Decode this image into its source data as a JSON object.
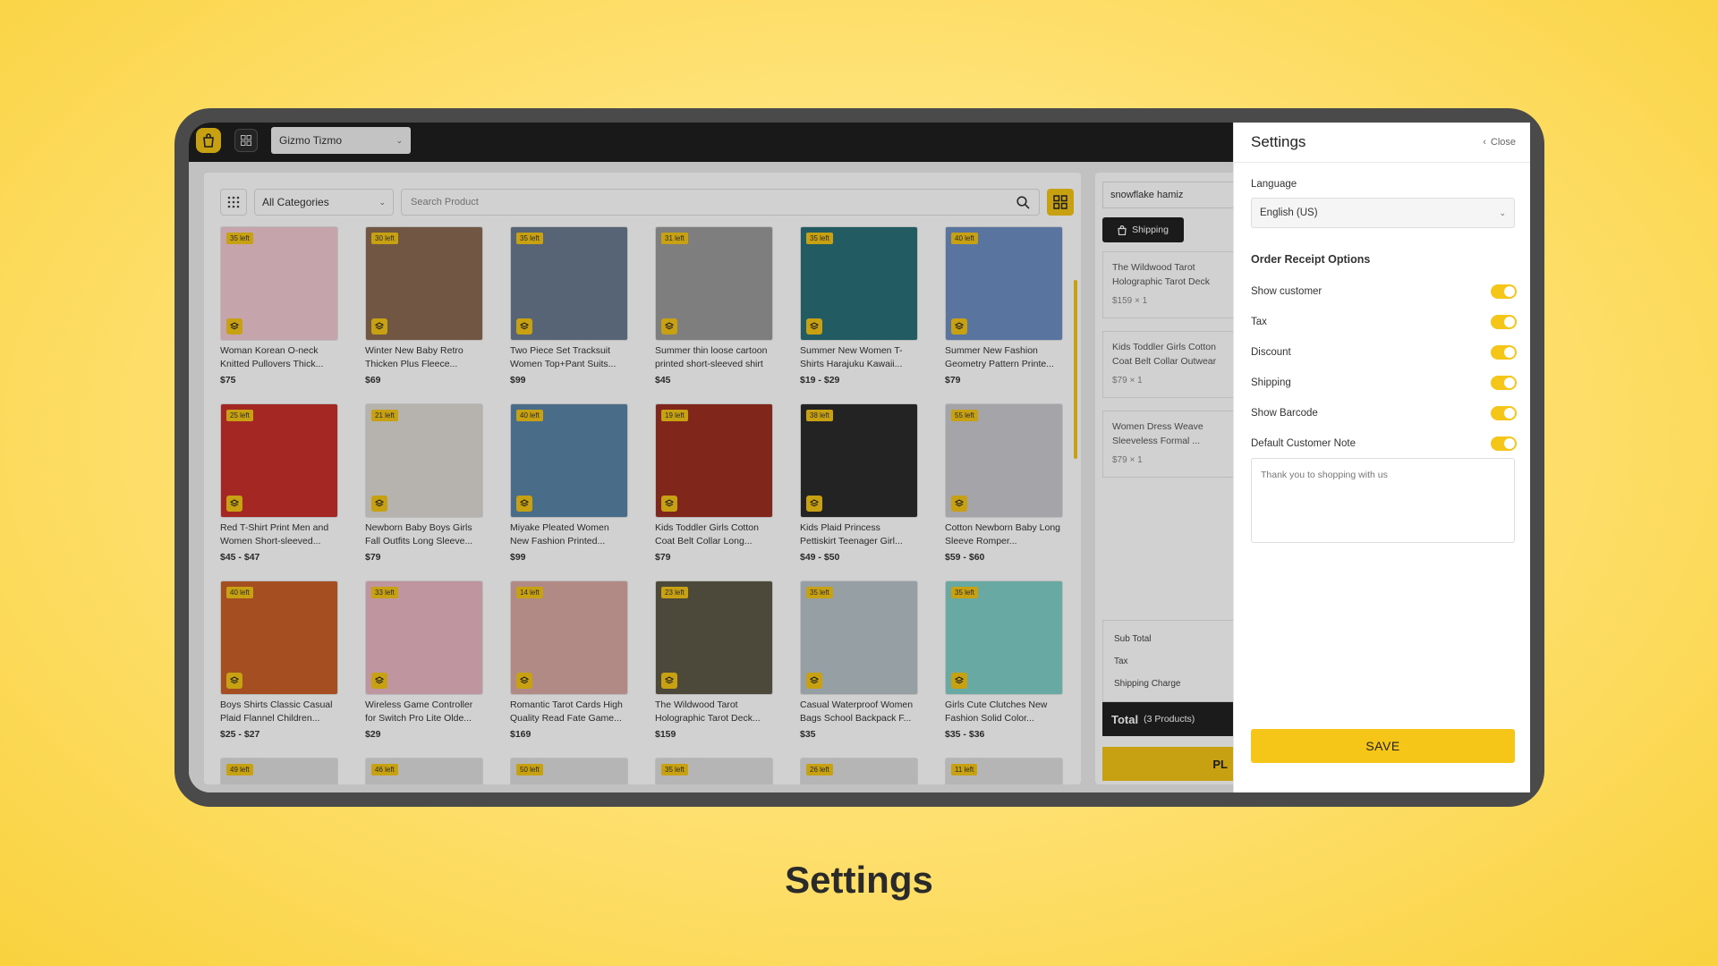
{
  "topbar": {
    "store_name": "Gizmo Tizmo"
  },
  "filters": {
    "category": "All Categories",
    "search_placeholder": "Search Product"
  },
  "products": [
    {
      "stock": "35 left",
      "name": "Woman Korean O-neck Knitted Pullovers Thick...",
      "price": "$75",
      "color": "#f2c9d1"
    },
    {
      "stock": "30 left",
      "name": "Winter New Baby Retro Thicken Plus Fleece...",
      "price": "$69",
      "color": "#8a6a52"
    },
    {
      "stock": "35 left",
      "name": "Two Piece Set Tracksuit Women Top+Pant Suits...",
      "price": "$99",
      "color": "#6b7a91"
    },
    {
      "stock": "31 left",
      "name": "Summer thin loose cartoon printed short-sleeved shirt",
      "price": "$45",
      "color": "#9a9a9a"
    },
    {
      "stock": "35 left",
      "name": "Summer New Women T-Shirts Harajuku Kawaii...",
      "price": "$19 - $29",
      "color": "#2a6f78"
    },
    {
      "stock": "40 left",
      "name": "Summer New Fashion Geometry Pattern Printe...",
      "price": "$79",
      "color": "#6d8fc2"
    },
    {
      "stock": "25 left",
      "name": "Red T-Shirt Print Men and Women Short-sleeved...",
      "price": "$45 - $47",
      "color": "#c9302c"
    },
    {
      "stock": "21 left",
      "name": "Newborn Baby Boys Girls Fall Outfits Long Sleeve...",
      "price": "$79",
      "color": "#ded9d3"
    },
    {
      "stock": "40 left",
      "name": "Miyake Pleated Women New Fashion Printed...",
      "price": "$99",
      "color": "#5a86a8"
    },
    {
      "stock": "19 left",
      "name": "Kids Toddler Girls Cotton Coat Belt Collar Long...",
      "price": "$79",
      "color": "#9e2f22"
    },
    {
      "stock": "38 left",
      "name": "Kids Plaid Princess Pettiskirt Teenager Girl...",
      "price": "$49 - $50",
      "color": "#2b2b2b"
    },
    {
      "stock": "55 left",
      "name": "Cotton Newborn Baby Long Sleeve Romper...",
      "price": "$59 - $60",
      "color": "#c9c9cf"
    },
    {
      "stock": "40 left",
      "name": "Boys Shirts Classic Casual Plaid Flannel Children...",
      "price": "$25 - $27",
      "color": "#c8602a"
    },
    {
      "stock": "33 left",
      "name": "Wireless Game Controller for Switch Pro Lite Olde...",
      "price": "$29",
      "color": "#e9b6c2"
    },
    {
      "stock": "14 left",
      "name": "Romantic Tarot Cards High Quality Read Fate Game...",
      "price": "$169",
      "color": "#d9a9a3"
    },
    {
      "stock": "23 left",
      "name": "The Wildwood Tarot Holographic Tarot Deck...",
      "price": "$159",
      "color": "#5d5a47"
    },
    {
      "stock": "35 left",
      "name": "Casual Waterproof Women Bags School Backpack F...",
      "price": "$35",
      "color": "#b7c4c8"
    },
    {
      "stock": "35 left",
      "name": "Girls Cute Clutches New Fashion Solid Color...",
      "price": "$35 - $36",
      "color": "#7fcfc9"
    },
    {
      "stock": "49 left",
      "name": "",
      "price": "",
      "color": "#dddddd"
    },
    {
      "stock": "46 left",
      "name": "",
      "price": "",
      "color": "#dddddd"
    },
    {
      "stock": "50 left",
      "name": "",
      "price": "",
      "color": "#dddddd"
    },
    {
      "stock": "35 left",
      "name": "",
      "price": "",
      "color": "#dddddd"
    },
    {
      "stock": "26 left",
      "name": "",
      "price": "",
      "color": "#dddddd"
    },
    {
      "stock": "11 left",
      "name": "",
      "price": "",
      "color": "#dddddd"
    }
  ],
  "cart": {
    "customer": "snowflake hamiz",
    "shipping_label": "Shipping",
    "items": [
      {
        "name": "The Wildwood Tarot Holographic Tarot Deck Adults Fate Divination ...",
        "qty": "$159 × 1"
      },
      {
        "name": "Kids Toddler Girls Cotton Coat Belt Collar Outwear Jacket Fall Clothes ...",
        "qty": "$79 × 1"
      },
      {
        "name": "Women Dress Weave Sleeveless Formal ...",
        "qty": "$79 × 1"
      }
    ],
    "sub_total_label": "Sub Total",
    "tax_label": "Tax",
    "shipping_charge_label": "Shipping Charge",
    "total_label": "Total",
    "total_count": "(3 Products)",
    "place_label": "PL"
  },
  "settings": {
    "title": "Settings",
    "close_label": "Close",
    "language_label": "Language",
    "language_value": "English (US)",
    "receipt_title": "Order Receipt Options",
    "options": [
      {
        "label": "Show customer",
        "on": true
      },
      {
        "label": "Tax",
        "on": true
      },
      {
        "label": "Discount",
        "on": true
      },
      {
        "label": "Shipping",
        "on": true
      },
      {
        "label": "Show Barcode",
        "on": true
      },
      {
        "label": "Default Customer Note",
        "on": true
      }
    ],
    "note_text": "Thank you to shopping with us",
    "save_label": "SAVE"
  },
  "caption": "Settings",
  "colors": {
    "accent": "#f5c518",
    "dark": "#1f1f1f"
  }
}
